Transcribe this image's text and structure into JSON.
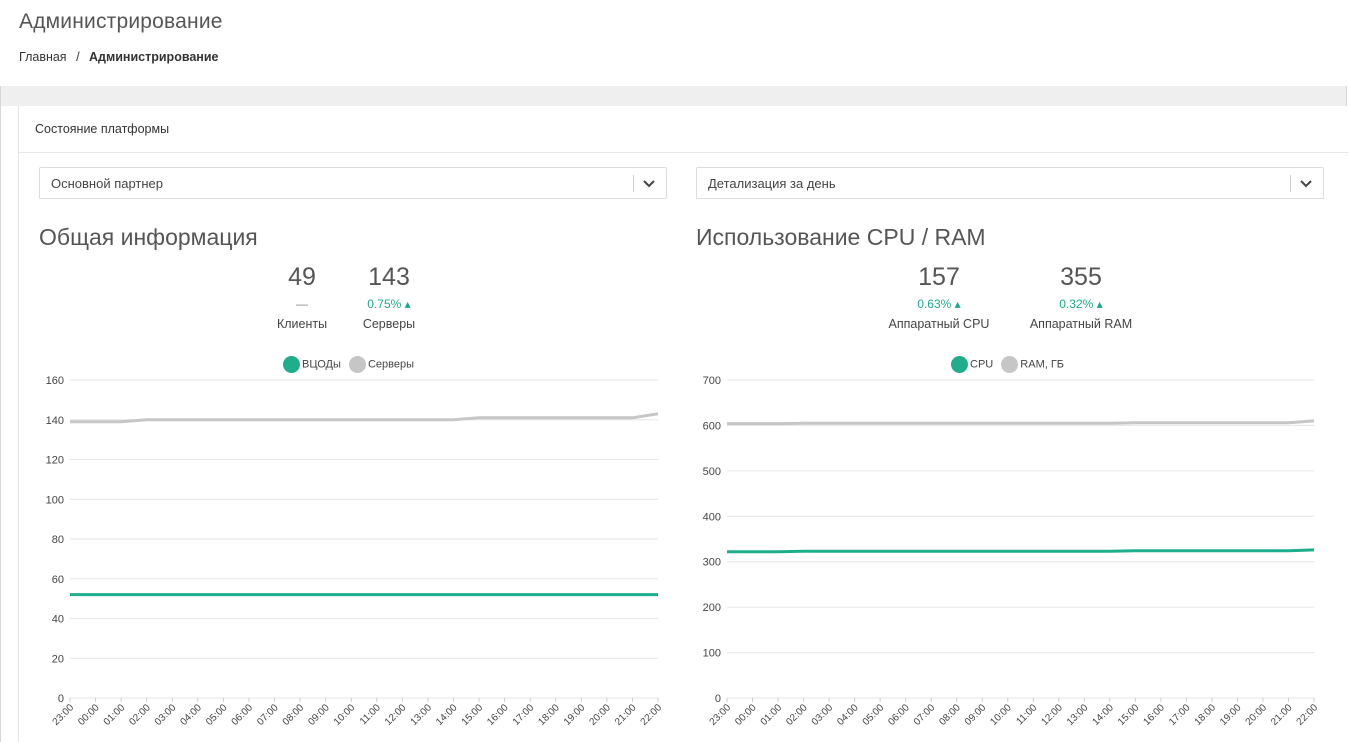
{
  "page": {
    "title": "Администрирование",
    "breadcrumb": {
      "home": "Главная",
      "separator": "/",
      "current": "Администрирование"
    }
  },
  "panel": {
    "title": "Состояние платформы",
    "partner_select": {
      "value": "Основной партнер",
      "icon": "chevron-down-icon"
    },
    "period_select": {
      "value": "Детализация за день",
      "icon": "chevron-down-icon"
    }
  },
  "general": {
    "title": "Общая информация",
    "stats": [
      {
        "value": "49",
        "delta": "—",
        "label": "Клиенты"
      },
      {
        "value": "143",
        "delta": "0.75% ▴",
        "label": "Серверы"
      }
    ],
    "legend": [
      {
        "name": "ВЦОДы",
        "color": "#1fae8b"
      },
      {
        "name": "Серверы",
        "color": "#c6c6c6"
      }
    ]
  },
  "usage": {
    "title": "Использование CPU / RAM",
    "stats": [
      {
        "value": "157",
        "delta": "0.63% ▴",
        "label": "Аппаратный CPU"
      },
      {
        "value": "355",
        "delta": "0.32% ▴",
        "label": "Аппаратный RAM"
      }
    ],
    "legend": [
      {
        "name": "CPU",
        "color": "#1fae8b"
      },
      {
        "name": "RAM, ГБ",
        "color": "#c6c6c6"
      }
    ]
  },
  "colors": {
    "accent": "#1fae8b",
    "secondary": "#c6c6c6",
    "grid": "#e6e6e6"
  },
  "chart_data": [
    {
      "type": "line",
      "x": [
        "23:00",
        "00:00",
        "01:00",
        "02:00",
        "03:00",
        "04:00",
        "05:00",
        "06:00",
        "07:00",
        "08:00",
        "09:00",
        "10:00",
        "11:00",
        "12:00",
        "13:00",
        "14:00",
        "15:00",
        "16:00",
        "17:00",
        "18:00",
        "19:00",
        "20:00",
        "21:00",
        "22:00"
      ],
      "ylim": [
        0,
        160
      ],
      "yticks": [
        0,
        20,
        40,
        60,
        80,
        100,
        120,
        140,
        160
      ],
      "series": [
        {
          "name": "ВЦОДы",
          "color": "#1fae8b",
          "values": [
            52,
            52,
            52,
            52,
            52,
            52,
            52,
            52,
            52,
            52,
            52,
            52,
            52,
            52,
            52,
            52,
            52,
            52,
            52,
            52,
            52,
            52,
            52,
            52
          ]
        },
        {
          "name": "Серверы",
          "color": "#c6c6c6",
          "values": [
            139,
            139,
            139,
            140,
            140,
            140,
            140,
            140,
            140,
            140,
            140,
            140,
            140,
            140,
            140,
            140,
            141,
            141,
            141,
            141,
            141,
            141,
            141,
            143
          ]
        }
      ],
      "grid": true,
      "legend_position": "top-center"
    },
    {
      "type": "line",
      "x": [
        "23:00",
        "00:00",
        "01:00",
        "02:00",
        "03:00",
        "04:00",
        "05:00",
        "06:00",
        "07:00",
        "08:00",
        "09:00",
        "10:00",
        "11:00",
        "12:00",
        "13:00",
        "14:00",
        "15:00",
        "16:00",
        "17:00",
        "18:00",
        "19:00",
        "20:00",
        "21:00",
        "22:00"
      ],
      "ylim": [
        0,
        700
      ],
      "yticks": [
        0,
        100,
        200,
        300,
        400,
        500,
        600,
        700
      ],
      "series": [
        {
          "name": "CPU",
          "color": "#1fae8b",
          "values": [
            322,
            322,
            322,
            323,
            323,
            323,
            323,
            323,
            323,
            323,
            323,
            323,
            323,
            323,
            323,
            323,
            324,
            324,
            324,
            324,
            324,
            324,
            324,
            326
          ]
        },
        {
          "name": "RAM, ГБ",
          "color": "#c6c6c6",
          "values": [
            604,
            604,
            604,
            605,
            605,
            605,
            605,
            605,
            605,
            605,
            605,
            605,
            605,
            605,
            605,
            605,
            606,
            606,
            606,
            606,
            606,
            606,
            606,
            610
          ]
        }
      ],
      "grid": true,
      "legend_position": "top-center"
    }
  ]
}
